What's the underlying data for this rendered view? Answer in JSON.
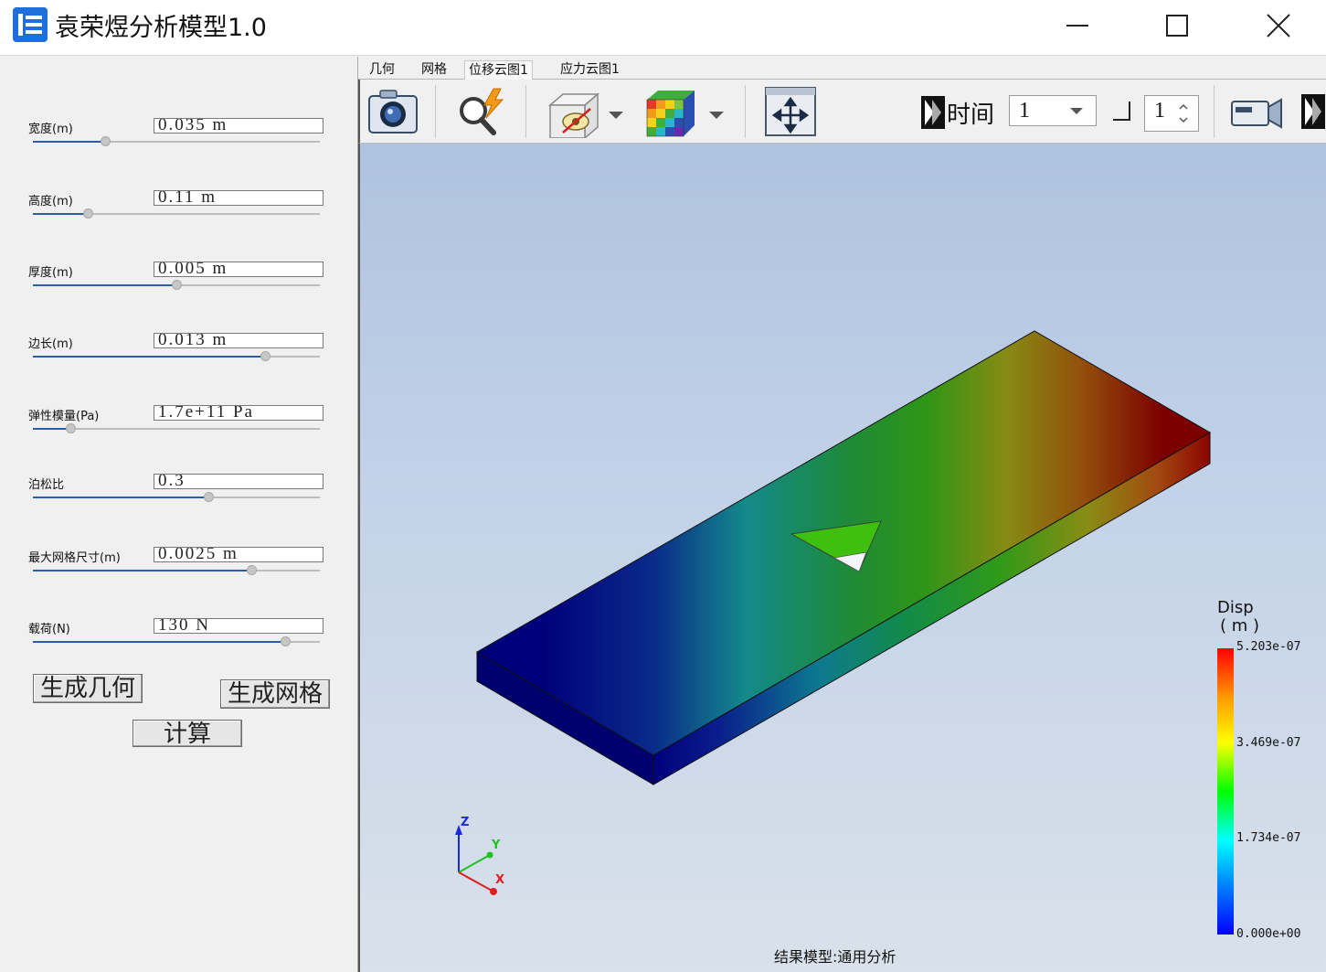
{
  "window": {
    "title": "袁荣煜分析模型1.0"
  },
  "params": [
    {
      "label": "宽度(m)",
      "value": "0.035 m",
      "slider": 0.25
    },
    {
      "label": "高度(m)",
      "value": "0.11 m",
      "slider": 0.19
    },
    {
      "label": "厚度(m)",
      "value": "0.005 m",
      "slider": 0.5
    },
    {
      "label": "边长(m)",
      "value": "0.013 m",
      "slider": 0.81
    },
    {
      "label": "弹性模量(Pa)",
      "value": "1.7e+11 Pa",
      "slider": 0.13
    },
    {
      "label": "泊松比",
      "value": "0.3",
      "slider": 0.61
    },
    {
      "label": "最大网格尺寸(m)",
      "value": "0.0025 m",
      "slider": 0.76
    },
    {
      "label": "载荷(N)",
      "value": "130 N",
      "slider": 0.88
    }
  ],
  "buttons": {
    "generate_geometry": "生成几何",
    "generate_mesh": "生成网格",
    "compute": "计算"
  },
  "tabs": [
    "几何",
    "网格",
    "位移云图1",
    "应力云图1"
  ],
  "active_tab": 2,
  "toolbar": {
    "time_label": "时间",
    "time_value": "1",
    "step_value": "1"
  },
  "legend": {
    "title": "Disp",
    "unit": "( m )",
    "ticks": [
      "5.203e-07",
      "3.469e-07",
      "1.734e-07",
      "0.000e+00"
    ]
  },
  "axes": {
    "x": "X",
    "y": "Y",
    "z": "Z"
  },
  "status": "结果模型:通用分析",
  "colors": {
    "accent": "#2a5ca8",
    "legend_max": "#ff0000",
    "legend_min": "#0000ff"
  }
}
